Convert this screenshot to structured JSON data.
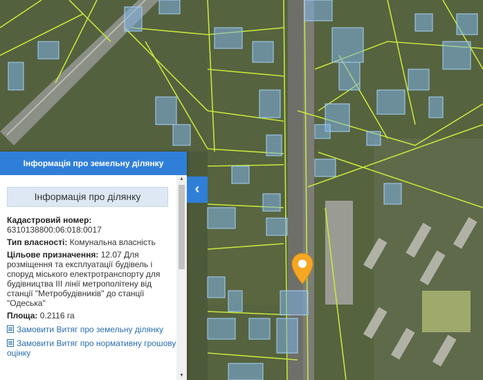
{
  "panel": {
    "header_title": "Інформація про земельну ділянку",
    "section_title": "Інформація про ділянку",
    "cadastral_label": "Кадастровий номер:",
    "cadastral_value": "6310138800:06:018:0017",
    "ownership_label": "Тип власності:",
    "ownership_value": "Комунальна власність",
    "purpose_label": "Цільове призначення:",
    "purpose_value": "12.07 Для розміщення та експлуатації будівель і споруд міського електротранспорту для будівництва III лінії метрополітену від станції \"Метробудівників\" до станції \"Одеська\"",
    "area_label": "Площа:",
    "area_value": "0.2116 га",
    "link_extract": "Замовити Витяг про земельну ділянку",
    "link_valuation": "Замовити Витяг про нормативну грошову оцінку"
  },
  "controls": {
    "collapse_glyph": "‹",
    "scroll_up_glyph": "▲",
    "scroll_down_glyph": "▼"
  },
  "icons": {
    "collapse": "chevron-left-icon",
    "marker": "map-pin-icon",
    "document": "document-icon"
  },
  "colors": {
    "accent": "#2f7fd9",
    "marker": "#f5a623",
    "parcel_line": "#c8e63c",
    "building_fill": "#7fb3e6"
  }
}
